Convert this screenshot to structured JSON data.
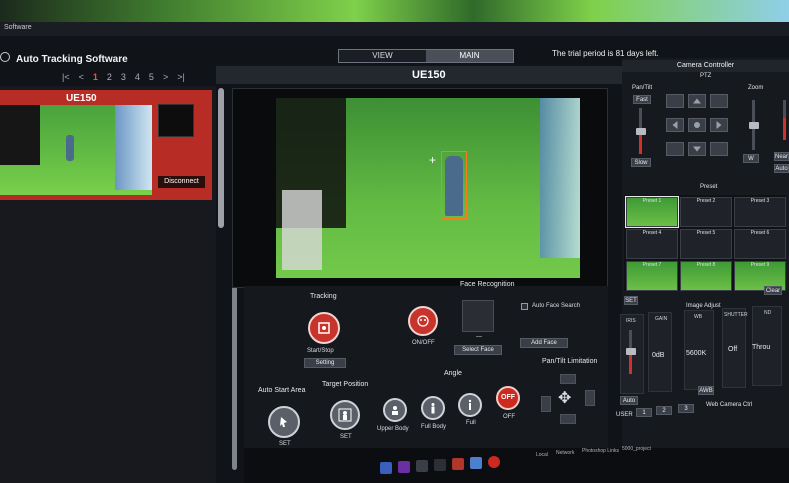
{
  "window": {
    "title": "Software"
  },
  "app": {
    "name": "Auto Tracking Software"
  },
  "tabs": [
    {
      "label": "VIEW",
      "active": false
    },
    {
      "label": "MAIN",
      "active": true
    }
  ],
  "trial_text": "The trial period is 81 days left.",
  "pager": {
    "items": [
      "|<",
      "<",
      "1",
      "2",
      "3",
      "4",
      "5",
      ">",
      ">|"
    ],
    "current": "1"
  },
  "camera_list": [
    {
      "name": "UE150",
      "status": "connected",
      "action_label": "Disconnect"
    }
  ],
  "center": {
    "camera_title": "UE150"
  },
  "tracking": {
    "section_label": "Tracking",
    "start_stop_label": "Start/Stop",
    "setting_label": "Setting"
  },
  "face_recognition": {
    "section_label": "Face Recognition",
    "onoff_label": "ON/OFF",
    "face_placeholder": "—",
    "auto_face_search_label": "Auto Face Search",
    "select_face_label": "Select Face",
    "add_face_label": "Add Face"
  },
  "auto_start_area": {
    "section_label": "Auto Start Area",
    "set_label": "SET"
  },
  "target_position": {
    "section_label": "Target Position",
    "set_label": "SET"
  },
  "angle": {
    "section_label": "Angle",
    "options": [
      "Upper Body",
      "Full Body",
      "Full",
      "OFF"
    ],
    "off_badge": "OFF"
  },
  "pan_tilt_limitation": {
    "section_label": "Pan/Tilt Limitation"
  },
  "camera_controller": {
    "title": "Camera Controller",
    "ptz_label": "PTZ",
    "pan_tilt_label": "Pan/Tilt",
    "zoom_label": "Zoom",
    "fast_label": "Fast",
    "slow_label": "Slow",
    "w_label": "W",
    "near_label": "Near",
    "auto_label": "Auto",
    "preset_label": "Preset",
    "presets": [
      "Preset 1",
      "Preset 2",
      "Preset 3",
      "Preset 4",
      "Preset 5",
      "Preset 6",
      "Preset 7",
      "Preset 8",
      "Preset 9"
    ],
    "preset_set_label": "SET",
    "preset_clear_label": "Clear",
    "image_adjust_label": "Image Adjust",
    "image_adjust": [
      {
        "label": "IRIS",
        "value": ""
      },
      {
        "label": "GAIN",
        "value": "0dB"
      },
      {
        "label": "WB",
        "value": "5600K"
      },
      {
        "label": "SHUTTER",
        "value": "Off"
      },
      {
        "label": "ND",
        "value": "Throu"
      }
    ],
    "iris_auto_label": "Auto",
    "awb_label": "AWB",
    "user_label": "USER",
    "user_buttons": [
      "1",
      "2",
      "3"
    ],
    "web_camera_ctrl_label": "Web Camera Ctrl"
  },
  "taskbar": {
    "labels": [
      "Local",
      "Network",
      "Photoshop Links",
      "5000_project"
    ]
  },
  "colors": {
    "accent_red": "#c8332c",
    "tracking_orange": "#ff7a1a",
    "panel_dark": "#16191e"
  }
}
